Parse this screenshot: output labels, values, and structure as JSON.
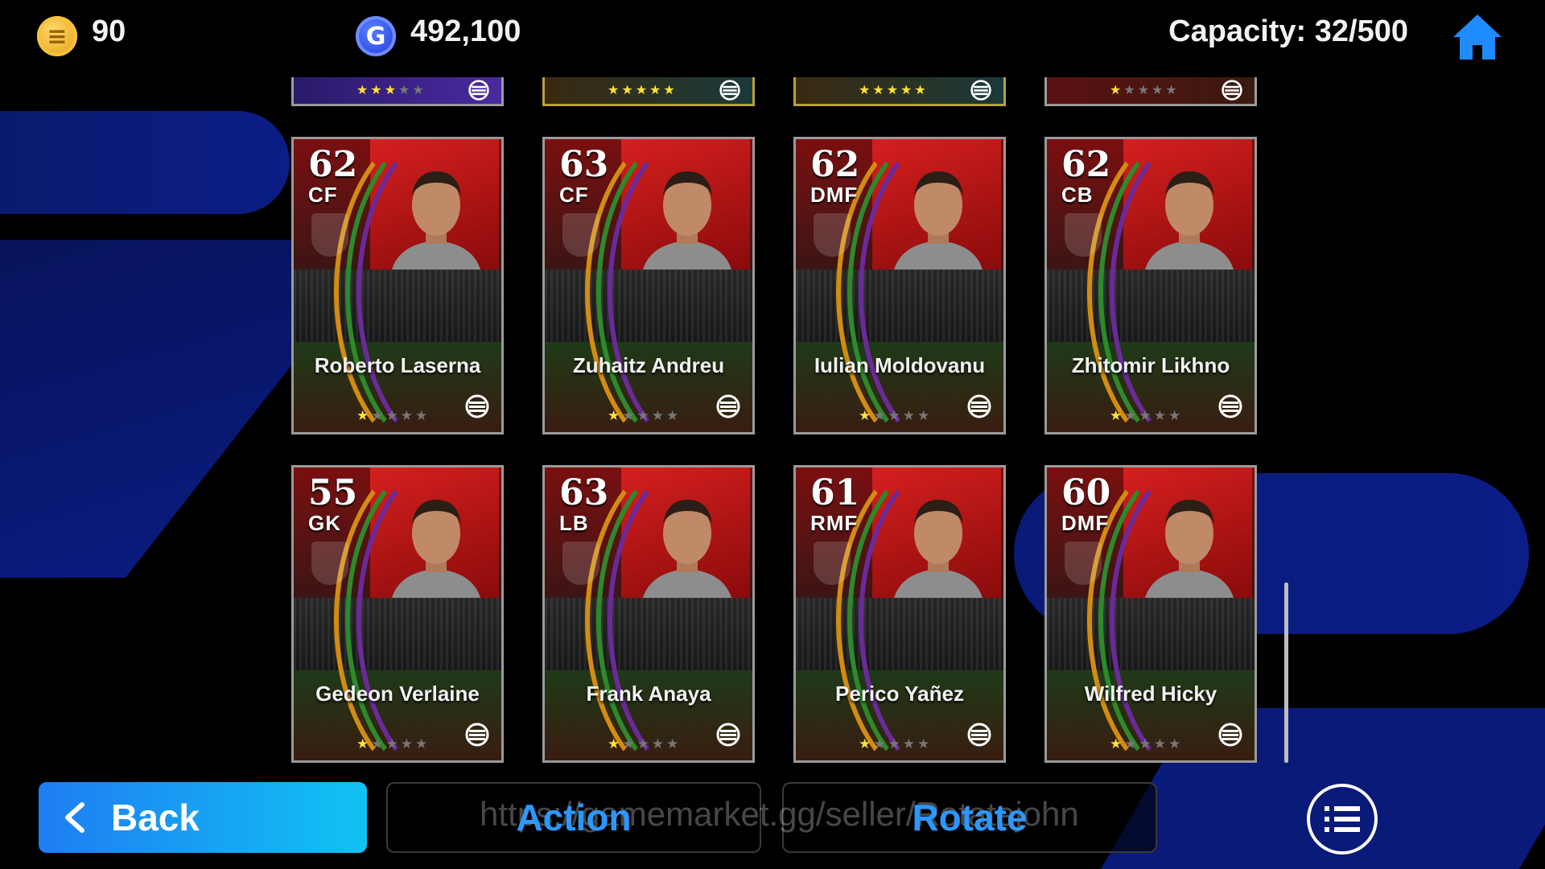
{
  "topbar": {
    "ecoins": "90",
    "gp": "492,100",
    "capacity": "Capacity: 32/500"
  },
  "partial_row": [
    {
      "stars": 3,
      "frame": "purple"
    },
    {
      "stars": 5,
      "frame": "gold"
    },
    {
      "stars": 5,
      "frame": "gold"
    },
    {
      "stars": 1,
      "frame": "red"
    }
  ],
  "players": [
    {
      "rating": "62",
      "position": "CF",
      "name": "Roberto Laserna",
      "stars": 1
    },
    {
      "rating": "63",
      "position": "CF",
      "name": "Zuhaitz Andreu",
      "stars": 1
    },
    {
      "rating": "62",
      "position": "DMF",
      "name": "Iulian Moldovanu",
      "stars": 1
    },
    {
      "rating": "62",
      "position": "CB",
      "name": "Zhitomir Likhno",
      "stars": 1
    },
    {
      "rating": "55",
      "position": "GK",
      "name": "Gedeon Verlaine",
      "stars": 1
    },
    {
      "rating": "63",
      "position": "LB",
      "name": "Frank Anaya",
      "stars": 1
    },
    {
      "rating": "61",
      "position": "RMF",
      "name": "Perico Yañez",
      "stars": 1
    },
    {
      "rating": "60",
      "position": "DMF",
      "name": "Wilfred Hicky",
      "stars": 1
    }
  ],
  "bottombar": {
    "back_label": "Back",
    "action_label": "Action",
    "rotate_label": "Rotate",
    "watermark": "https://gamemarket.gg/seller/Rotatejohn"
  },
  "colors": {
    "accent": "#2c98ff",
    "back_gradient_start": "#1f7df2",
    "back_gradient_end": "#10c3f2",
    "card_red": "#d61f1f",
    "star_on": "#ffe13a"
  }
}
